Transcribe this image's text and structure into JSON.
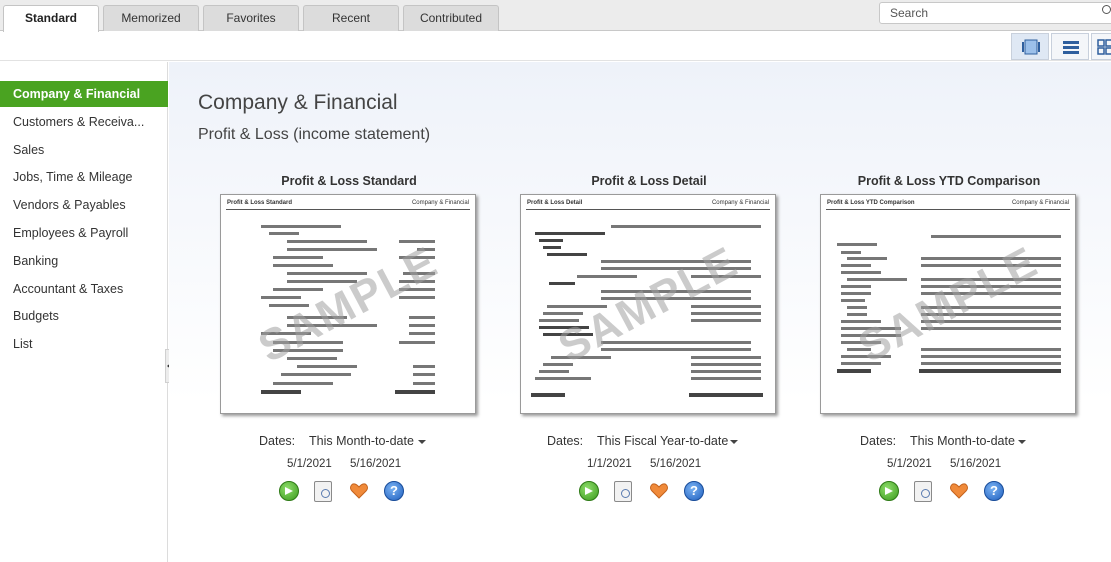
{
  "tabs": [
    {
      "label": "Standard",
      "active": true
    },
    {
      "label": "Memorized",
      "active": false
    },
    {
      "label": "Favorites",
      "active": false
    },
    {
      "label": "Recent",
      "active": false
    },
    {
      "label": "Contributed",
      "active": false
    }
  ],
  "search": {
    "placeholder": "Search"
  },
  "sidebar": {
    "items": [
      {
        "label": "Company & Financial",
        "active": true
      },
      {
        "label": "Customers & Receiva...",
        "active": false
      },
      {
        "label": "Sales",
        "active": false
      },
      {
        "label": "Jobs, Time & Mileage",
        "active": false
      },
      {
        "label": "Vendors & Payables",
        "active": false
      },
      {
        "label": "Employees & Payroll",
        "active": false
      },
      {
        "label": "Banking",
        "active": false
      },
      {
        "label": "Accountant & Taxes",
        "active": false
      },
      {
        "label": "Budgets",
        "active": false
      },
      {
        "label": "List",
        "active": false
      }
    ]
  },
  "main": {
    "heading": "Company & Financial",
    "subheading": "Profit & Loss (income statement)",
    "reports": [
      {
        "title": "Profit & Loss Standard",
        "thumb_header": "Profit & Loss Standard",
        "thumb_category": "Company & Financial",
        "dates_label": "Dates:",
        "dates_value": "This Month-to-date",
        "from": "5/1/2021",
        "to": "5/16/2021"
      },
      {
        "title": "Profit & Loss Detail",
        "thumb_header": "Profit & Loss Detail",
        "thumb_category": "Company & Financial",
        "dates_label": "Dates:",
        "dates_value": "This Fiscal Year-to-date",
        "from": "1/1/2021",
        "to": "5/16/2021"
      },
      {
        "title": "Profit & Loss YTD Comparison",
        "thumb_header": "Profit & Loss YTD Comparison",
        "thumb_category": "Company & Financial",
        "dates_label": "Dates:",
        "dates_value": "This Month-to-date",
        "from": "5/1/2021",
        "to": "5/16/2021"
      }
    ],
    "watermark": "SAMPLE"
  },
  "icons": {
    "run": "run-report-icon",
    "info": "report-info-icon",
    "favorite": "favorite-heart-icon",
    "help": "help-icon"
  },
  "colors": {
    "accent": "#4aa321"
  }
}
